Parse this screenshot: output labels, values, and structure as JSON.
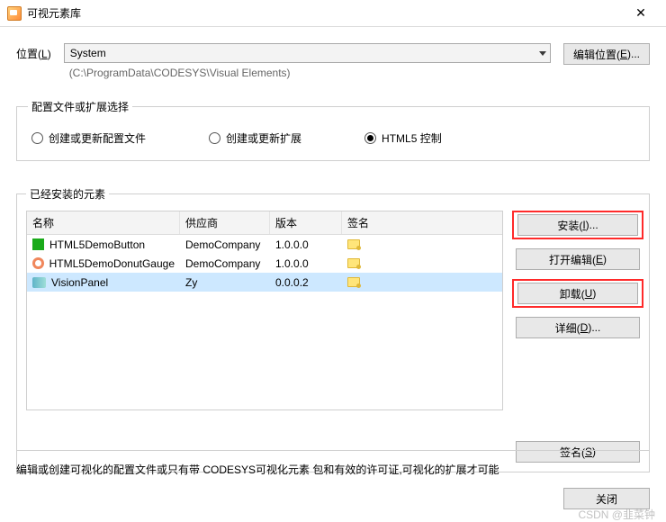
{
  "window": {
    "title": "可视元素库",
    "close_symbol": "✕"
  },
  "location": {
    "label_prefix": "位置(",
    "label_underline": "L",
    "label_suffix": ")",
    "value": "System",
    "path": "(C:\\ProgramData\\CODESYS\\Visual Elements)",
    "edit_btn_prefix": "编辑位置(",
    "edit_btn_underline": "E",
    "edit_btn_suffix": ")..."
  },
  "config": {
    "legend": "配置文件或扩展选择",
    "options": [
      {
        "label": "创建或更新配置文件",
        "checked": false
      },
      {
        "label": "创建或更新扩展",
        "checked": false
      },
      {
        "label": "HTML5 控制",
        "checked": true
      }
    ]
  },
  "installed": {
    "legend": "已经安装的元素",
    "columns": {
      "name": "名称",
      "vendor": "供应商",
      "version": "版本",
      "sign": "签名"
    },
    "rows": [
      {
        "icon": "square",
        "name": "HTML5DemoButton",
        "vendor": "DemoCompany",
        "version": "1.0.0.0",
        "selected": false
      },
      {
        "icon": "donut",
        "name": "HTML5DemoDonutGauge",
        "vendor": "DemoCompany",
        "version": "1.0.0.0",
        "selected": false
      },
      {
        "icon": "panel",
        "name": "VisionPanel",
        "vendor": "Zy",
        "version": "0.0.0.2",
        "selected": true
      }
    ],
    "buttons": {
      "install": {
        "pre": "安装(",
        "u": "I",
        "post": ")...",
        "highlight": true
      },
      "edit_open": {
        "pre": "打开编辑(",
        "u": "E",
        "post": ")",
        "highlight": false
      },
      "uninstall": {
        "pre": "卸载(",
        "u": "U",
        "post": ")",
        "highlight": true
      },
      "details": {
        "pre": "详细(",
        "u": "D",
        "post": ")...",
        "highlight": false
      },
      "sign": {
        "pre": "签名(",
        "u": "S",
        "post": ")",
        "highlight": false
      }
    }
  },
  "footer": {
    "description": "编辑或创建可视化的配置文件或只有带 CODESYS可视化元素 包和有效的许可证,可视化的扩展才可能",
    "close_btn": "关闭"
  },
  "watermark": "CSDN @韭菜钟"
}
